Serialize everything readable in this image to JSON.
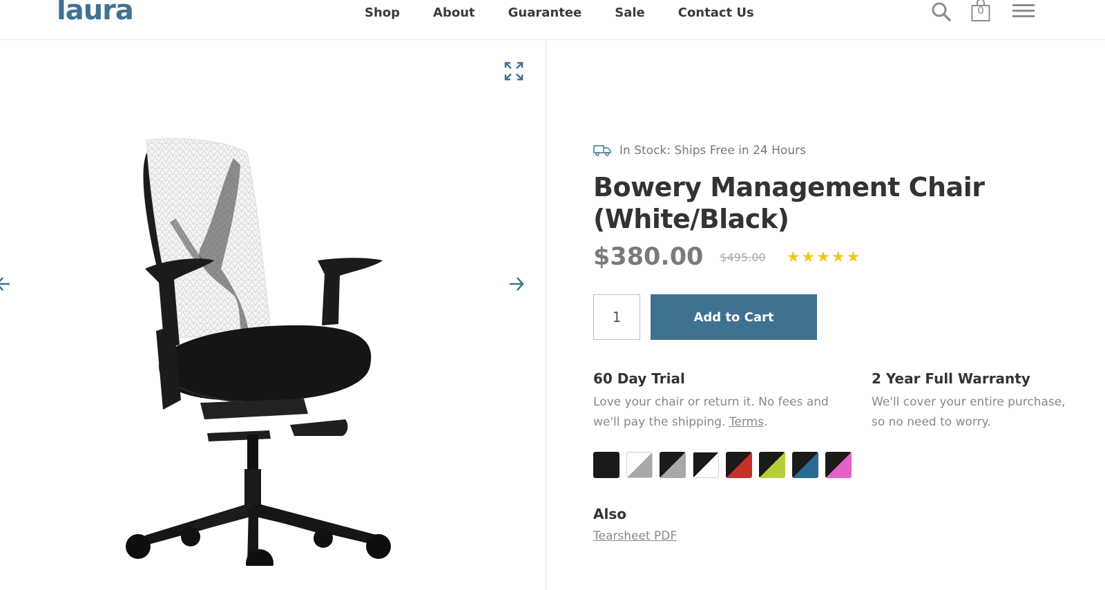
{
  "brand": {
    "logo": "laura",
    "accent": "#3f7290"
  },
  "nav": {
    "items": [
      {
        "label": "Shop"
      },
      {
        "label": "About"
      },
      {
        "label": "Guarantee"
      },
      {
        "label": "Sale"
      },
      {
        "label": "Contact Us"
      }
    ]
  },
  "header_icons": {
    "search": "search-icon",
    "cart": "shopping-bag-icon",
    "cart_count": "0",
    "menu": "hamburger-menu-icon"
  },
  "gallery": {
    "expand": "expand-icon",
    "prev": "arrow-left-icon",
    "next": "arrow-right-icon",
    "image": "office-chair-white-black"
  },
  "product": {
    "stock_text": "In Stock: Ships Free in 24 Hours",
    "title": "Bowery Management Chair (White/Black)",
    "price": "$380.00",
    "old_price": "$495.00",
    "rating": 5,
    "star_color": "#f5c518",
    "quantity": "1",
    "add_to_cart": "Add to Cart"
  },
  "features": {
    "trial": {
      "title": "60 Day Trial",
      "text": "Love your chair or return it. No fees and we'll pay the shipping.",
      "link": "Terms",
      "suffix": "."
    },
    "warranty": {
      "title": "2 Year Full Warranty",
      "text": "We'll cover your entire purchase, so no need to worry."
    }
  },
  "swatches": [
    {
      "name": "black",
      "a": "#1a1a1a",
      "b": "#1a1a1a"
    },
    {
      "name": "white-gray",
      "a": "#ffffff",
      "b": "#a8a8a8"
    },
    {
      "name": "black-gray",
      "a": "#1a1a1a",
      "b": "#a8a8a8"
    },
    {
      "name": "black-white",
      "a": "#1a1a1a",
      "b": "#ffffff"
    },
    {
      "name": "black-red",
      "a": "#1a1a1a",
      "b": "#c8302c"
    },
    {
      "name": "black-green",
      "a": "#1a1a1a",
      "b": "#b5cf3a"
    },
    {
      "name": "black-blue",
      "a": "#1a1a1a",
      "b": "#2a6a95"
    },
    {
      "name": "black-pink",
      "a": "#1a1a1a",
      "b": "#e561c8"
    }
  ],
  "also": {
    "heading": "Also",
    "pdf_link": "Tearsheet PDF"
  }
}
